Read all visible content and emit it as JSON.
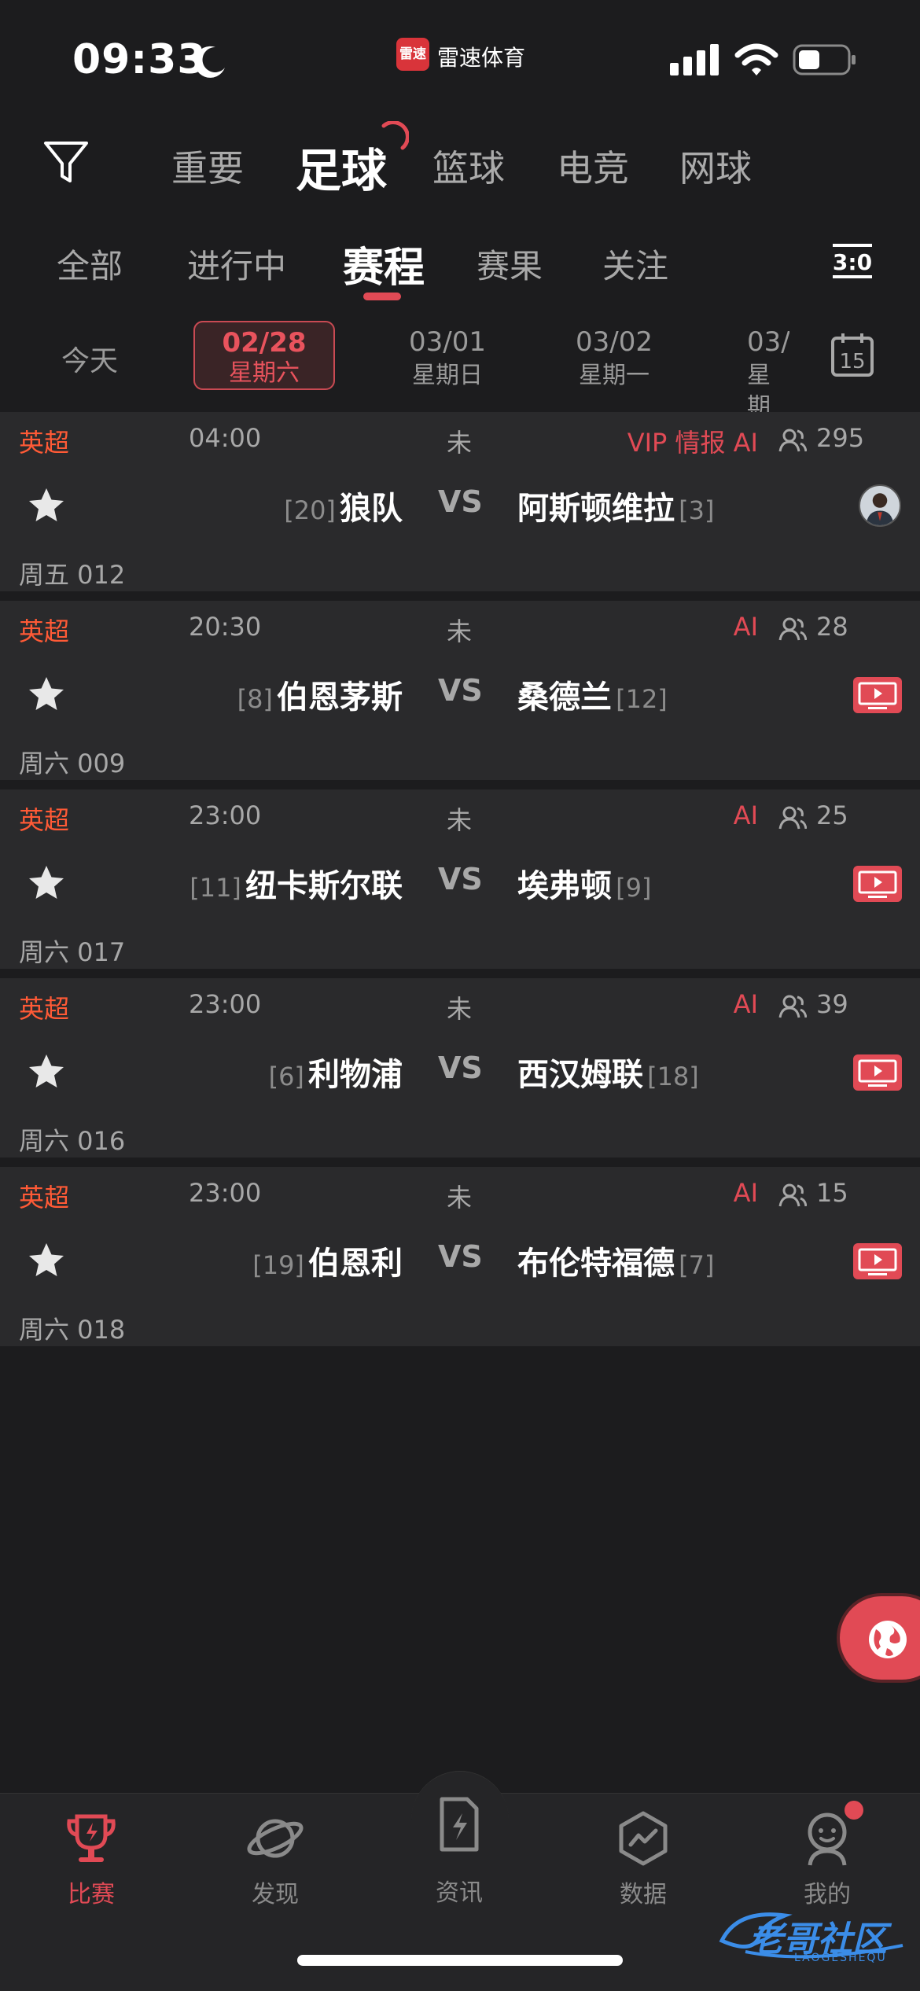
{
  "status_bar": {
    "time": "09:33",
    "app_badge": "雷速",
    "app_name": "雷速体育"
  },
  "sport_tabs": [
    {
      "label": "重要",
      "active": false
    },
    {
      "label": "足球",
      "active": true
    },
    {
      "label": "篮球",
      "active": false
    },
    {
      "label": "电竞",
      "active": false
    },
    {
      "label": "网球",
      "active": false
    }
  ],
  "sub_tabs": [
    {
      "label": "全部"
    },
    {
      "label": "进行中"
    },
    {
      "label": "赛程",
      "active": true
    },
    {
      "label": "赛果"
    },
    {
      "label": "关注"
    }
  ],
  "score_icon_text": "3:0",
  "dates": {
    "today": "今天",
    "items": [
      {
        "date": "02/28",
        "weekday": "星期六",
        "selected": true
      },
      {
        "date": "03/01",
        "weekday": "星期日"
      },
      {
        "date": "03/02",
        "weekday": "星期一"
      },
      {
        "date": "03/",
        "weekday": "星期"
      }
    ],
    "calendar_day": "15"
  },
  "matches": [
    {
      "league": "英超",
      "time": "04:00",
      "state": "未",
      "tags": "VIP 情报  AI",
      "viewers": "295",
      "home": {
        "rank": "[20]",
        "name": "狼队"
      },
      "vs": "VS",
      "away": {
        "name": "阿斯顿维拉",
        "rank": "[3]"
      },
      "code": "周五 012",
      "right": "avatar"
    },
    {
      "league": "英超",
      "time": "20:30",
      "state": "未",
      "tags": "AI",
      "viewers": "28",
      "home": {
        "rank": "[8]",
        "name": "伯恩茅斯"
      },
      "vs": "VS",
      "away": {
        "name": "桑德兰",
        "rank": "[12]"
      },
      "code": "周六 009",
      "right": "tv"
    },
    {
      "league": "英超",
      "time": "23:00",
      "state": "未",
      "tags": "AI",
      "viewers": "25",
      "home": {
        "rank": "[11]",
        "name": "纽卡斯尔联"
      },
      "vs": "VS",
      "away": {
        "name": "埃弗顿",
        "rank": "[9]"
      },
      "code": "周六 017",
      "right": "tv"
    },
    {
      "league": "英超",
      "time": "23:00",
      "state": "未",
      "tags": "AI",
      "viewers": "39",
      "home": {
        "rank": "[6]",
        "name": "利物浦"
      },
      "vs": "VS",
      "away": {
        "name": "西汉姆联",
        "rank": "[18]"
      },
      "code": "周六 016",
      "right": "tv"
    },
    {
      "league": "英超",
      "time": "23:00",
      "state": "未",
      "tags": "AI",
      "viewers": "15",
      "home": {
        "rank": "[19]",
        "name": "伯恩利"
      },
      "vs": "VS",
      "away": {
        "name": "布伦特福德",
        "rank": "[7]"
      },
      "code": "周六 018",
      "right": "tv"
    }
  ],
  "bottom_nav": [
    {
      "label": "比赛",
      "icon": "trophy-icon",
      "active": true
    },
    {
      "label": "发现",
      "icon": "planet-icon"
    },
    {
      "label": "资讯",
      "icon": "news-icon"
    },
    {
      "label": "数据",
      "icon": "data-icon"
    },
    {
      "label": "我的",
      "icon": "profile-icon"
    }
  ],
  "watermark": {
    "text": "老哥社区",
    "sub": "LAOGESHEQU"
  },
  "colors": {
    "accent": "#e14a55",
    "league": "#ff5a36",
    "background": "#1c1c1e",
    "card": "#2a2a2c"
  }
}
